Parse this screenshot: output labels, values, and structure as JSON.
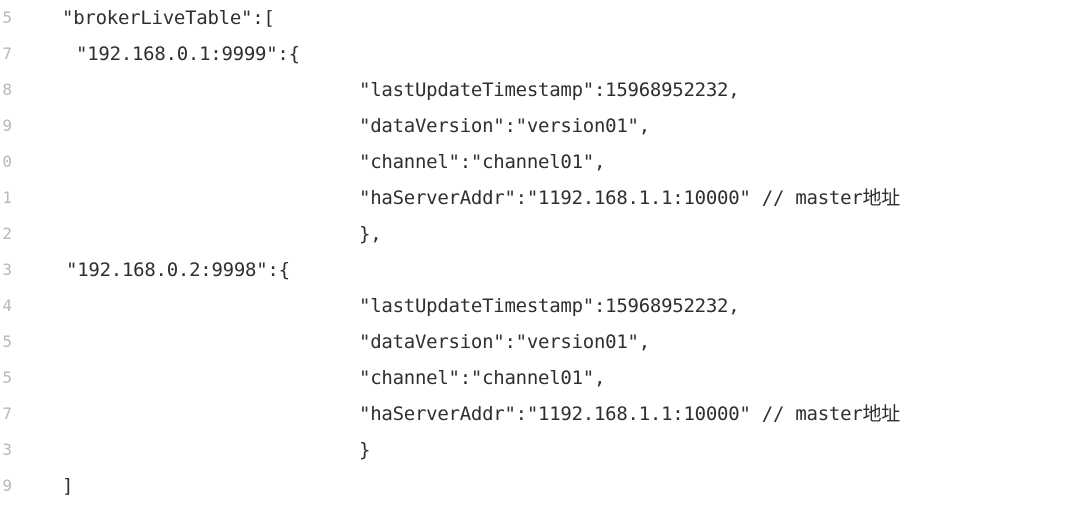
{
  "editor": {
    "line_numbers": [
      "5",
      "7",
      "8",
      "9",
      "0",
      "1",
      "2",
      "3",
      "4",
      "5",
      "5",
      "7",
      "3",
      "9"
    ],
    "lines": [
      "\"brokerLiveTable\":[",
      "\"192.168.0.1:9999\":{",
      "\"lastUpdateTimestamp\":15968952232,",
      "\"dataVersion\":\"version01\",",
      "\"channel\":\"channel01\",",
      "\"haServerAddr\":\"1192.168.1.1:10000\" // master地址",
      "},",
      "\"192.168.0.2:9998\":{",
      "\"lastUpdateTimestamp\":15968952232,",
      "\"dataVersion\":\"version01\",",
      "\"channel\":\"channel01\",",
      "\"haServerAddr\":\"1192.168.1.1:10000\" // master地址",
      "}",
      "]"
    ]
  }
}
